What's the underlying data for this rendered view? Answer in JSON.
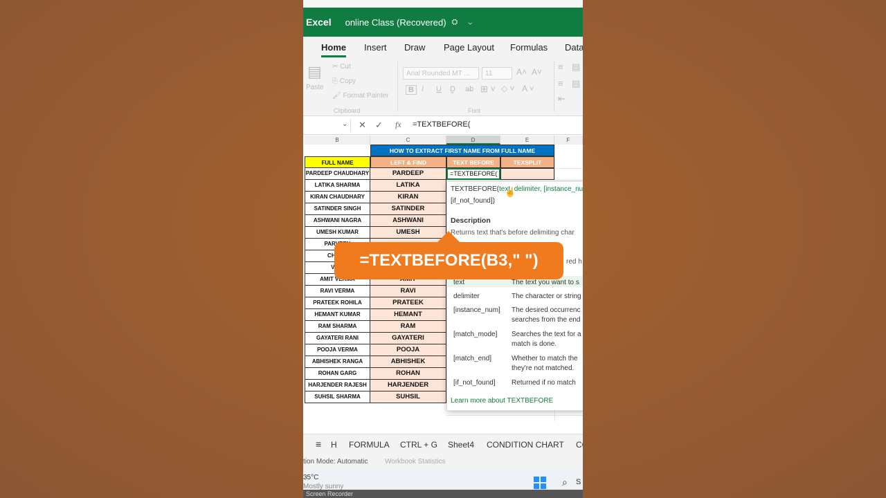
{
  "app": {
    "name": "Excel",
    "doc_title": "online Class (Recovered)",
    "title_icons": "⛭ ⌄"
  },
  "ribbon_tabs": [
    "Home",
    "Insert",
    "Draw",
    "Page Layout",
    "Formulas",
    "Data"
  ],
  "ribbon": {
    "paste": "Paste",
    "cut": "Cut",
    "copy": "Copy",
    "format_painter": "Format Painter",
    "clipboard": "Clipboard",
    "font_name": "Arial Rounded MT ...",
    "font_size": "11",
    "font_group": "Font",
    "bold": "B",
    "italic": "I",
    "underline": "U"
  },
  "formula_bar": {
    "fx": "fx",
    "formula": "=TEXTBEFORE("
  },
  "columns": [
    "B",
    "C",
    "D",
    "E",
    "F"
  ],
  "sheet": {
    "banner": "HOW TO EXTRACT FIRST NAME FROM FULL NAME",
    "headers": {
      "full_name": "FULL NAME",
      "left_find": "LEFT & FIND",
      "text_before": "TEXT BEFORE",
      "textsplit": "TEXSPLIT"
    },
    "edit_cell": "=TEXTBEFORE(",
    "rows": [
      {
        "full": "PARDEEP CHAUDHARY",
        "first": "PARDEEP"
      },
      {
        "full": "LATIKA SHARMA",
        "first": "LATIKA"
      },
      {
        "full": "KIRAN CHAUDHARY",
        "first": "KIRAN"
      },
      {
        "full": "SATINDER SINGH",
        "first": "SATINDER"
      },
      {
        "full": "ASHWANI NAGRA",
        "first": "ASHWANI"
      },
      {
        "full": "UMESH KUMAR",
        "first": "UMESH"
      },
      {
        "full": "PARVEEN",
        "first": ""
      },
      {
        "full": "CHARA",
        "first": ""
      },
      {
        "full": "VIDY",
        "first": ""
      },
      {
        "full": "AMIT VERMA",
        "first": "AMIT"
      },
      {
        "full": "RAVI VERMA",
        "first": "RAVI"
      },
      {
        "full": "PRATEEK ROHILA",
        "first": "PRATEEK"
      },
      {
        "full": "HEMANT KUMAR",
        "first": "HEMANT"
      },
      {
        "full": "RAM SHARMA",
        "first": "RAM"
      },
      {
        "full": "GAYATERI RANI",
        "first": "GAYATERI"
      },
      {
        "full": "POOJA VERMA",
        "first": "POOJA"
      },
      {
        "full": "ABHISHEK RANGA",
        "first": "ABHISHEK"
      },
      {
        "full": "ROHAN GARG",
        "first": "ROHAN"
      },
      {
        "full": "HARJENDER RAJESH",
        "first": "HARJENDER"
      },
      {
        "full": "SUHSIL SHARMA",
        "first": "SUHSIL"
      }
    ]
  },
  "tooltip": {
    "signature_fn": "TEXTBEFORE(",
    "signature_rest": "text, delimiter, [instance_num",
    "signature_line2": "[if_not_found])",
    "description_label": "Description",
    "description": "Returns text that's before delimiting char",
    "partial_line": "red h",
    "params": [
      {
        "name": "text",
        "desc": "The text you want to s"
      },
      {
        "name": "delimiter",
        "desc": "The character or string"
      },
      {
        "name": "[instance_num]",
        "desc": "The desired occurrenc",
        "desc2": "searches from the end"
      },
      {
        "name": "[match_mode]",
        "desc": "Searches the text for a",
        "desc2": "match is done."
      },
      {
        "name": "[match_end]",
        "desc": "Whether to match the",
        "desc2": "they're not matched."
      },
      {
        "name": "[if_not_found]",
        "desc": "Returned if no match"
      }
    ],
    "learn_more": "Learn more about TEXTBEFORE"
  },
  "callout": "=TEXTBEFORE(B3,\" \")",
  "sheet_tabs": [
    "H",
    "FORMULA",
    "CTRL + G",
    "Sheet4",
    "CONDITION CHART",
    "CO"
  ],
  "status": {
    "calc_mode": "tion Mode: Automatic",
    "workbook_stats": "Workbook Statistics"
  },
  "taskbar": {
    "temp": "35°C",
    "weather": "Mostly sunny",
    "search": "S"
  },
  "recorder": "Screen Recorder",
  "colors": {
    "excel_green": "#107c41",
    "banner_blue": "#0070c0",
    "header_yellow": "#ffff00",
    "header_orange": "#f4b183",
    "cell_peach": "#fce4d6",
    "callout_orange": "#f07a1e"
  }
}
